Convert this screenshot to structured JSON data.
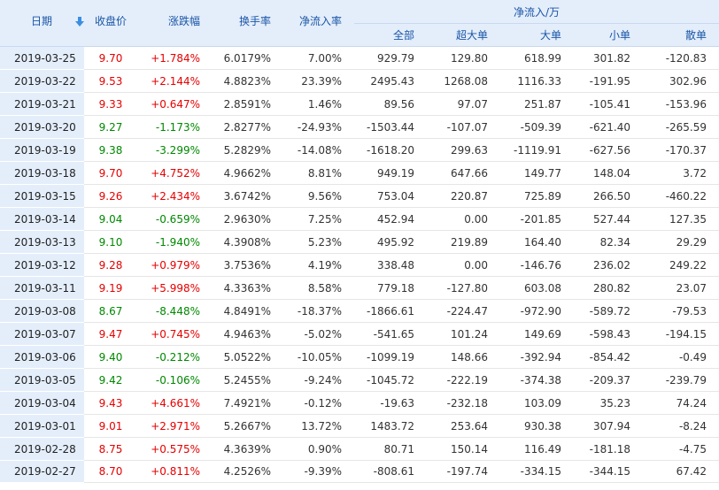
{
  "colors": {
    "up": "#e60000",
    "down": "#008800",
    "header_bg": "#e4eefb",
    "header_text": "#1a55a6"
  },
  "header": {
    "date": "日期",
    "sort_icon": "sort-down-arrow-icon",
    "close": "收盘价",
    "change": "涨跌幅",
    "turnover": "换手率",
    "net_rate": "净流入率",
    "net_group": "净流入/万",
    "all": "全部",
    "super_large": "超大单",
    "large": "大单",
    "small": "小单",
    "retail": "散单"
  },
  "rows": [
    {
      "date": "2019-03-25",
      "close": "9.70",
      "change": "+1.784%",
      "turnover": "6.0179%",
      "rate": "7.00%",
      "all": "929.79",
      "super": "129.80",
      "large": "618.99",
      "small": "301.82",
      "retail": "-120.83",
      "dir": "up"
    },
    {
      "date": "2019-03-22",
      "close": "9.53",
      "change": "+2.144%",
      "turnover": "4.8823%",
      "rate": "23.39%",
      "all": "2495.43",
      "super": "1268.08",
      "large": "1116.33",
      "small": "-191.95",
      "retail": "302.96",
      "dir": "up"
    },
    {
      "date": "2019-03-21",
      "close": "9.33",
      "change": "+0.647%",
      "turnover": "2.8591%",
      "rate": "1.46%",
      "all": "89.56",
      "super": "97.07",
      "large": "251.87",
      "small": "-105.41",
      "retail": "-153.96",
      "dir": "up"
    },
    {
      "date": "2019-03-20",
      "close": "9.27",
      "change": "-1.173%",
      "turnover": "2.8277%",
      "rate": "-24.93%",
      "all": "-1503.44",
      "super": "-107.07",
      "large": "-509.39",
      "small": "-621.40",
      "retail": "-265.59",
      "dir": "down"
    },
    {
      "date": "2019-03-19",
      "close": "9.38",
      "change": "-3.299%",
      "turnover": "5.2829%",
      "rate": "-14.08%",
      "all": "-1618.20",
      "super": "299.63",
      "large": "-1119.91",
      "small": "-627.56",
      "retail": "-170.37",
      "dir": "down"
    },
    {
      "date": "2019-03-18",
      "close": "9.70",
      "change": "+4.752%",
      "turnover": "4.9662%",
      "rate": "8.81%",
      "all": "949.19",
      "super": "647.66",
      "large": "149.77",
      "small": "148.04",
      "retail": "3.72",
      "dir": "up"
    },
    {
      "date": "2019-03-15",
      "close": "9.26",
      "change": "+2.434%",
      "turnover": "3.6742%",
      "rate": "9.56%",
      "all": "753.04",
      "super": "220.87",
      "large": "725.89",
      "small": "266.50",
      "retail": "-460.22",
      "dir": "up"
    },
    {
      "date": "2019-03-14",
      "close": "9.04",
      "change": "-0.659%",
      "turnover": "2.9630%",
      "rate": "7.25%",
      "all": "452.94",
      "super": "0.00",
      "large": "-201.85",
      "small": "527.44",
      "retail": "127.35",
      "dir": "down"
    },
    {
      "date": "2019-03-13",
      "close": "9.10",
      "change": "-1.940%",
      "turnover": "4.3908%",
      "rate": "5.23%",
      "all": "495.92",
      "super": "219.89",
      "large": "164.40",
      "small": "82.34",
      "retail": "29.29",
      "dir": "down"
    },
    {
      "date": "2019-03-12",
      "close": "9.28",
      "change": "+0.979%",
      "turnover": "3.7536%",
      "rate": "4.19%",
      "all": "338.48",
      "super": "0.00",
      "large": "-146.76",
      "small": "236.02",
      "retail": "249.22",
      "dir": "up"
    },
    {
      "date": "2019-03-11",
      "close": "9.19",
      "change": "+5.998%",
      "turnover": "4.3363%",
      "rate": "8.58%",
      "all": "779.18",
      "super": "-127.80",
      "large": "603.08",
      "small": "280.82",
      "retail": "23.07",
      "dir": "up"
    },
    {
      "date": "2019-03-08",
      "close": "8.67",
      "change": "-8.448%",
      "turnover": "4.8491%",
      "rate": "-18.37%",
      "all": "-1866.61",
      "super": "-224.47",
      "large": "-972.90",
      "small": "-589.72",
      "retail": "-79.53",
      "dir": "down"
    },
    {
      "date": "2019-03-07",
      "close": "9.47",
      "change": "+0.745%",
      "turnover": "4.9463%",
      "rate": "-5.02%",
      "all": "-541.65",
      "super": "101.24",
      "large": "149.69",
      "small": "-598.43",
      "retail": "-194.15",
      "dir": "up"
    },
    {
      "date": "2019-03-06",
      "close": "9.40",
      "change": "-0.212%",
      "turnover": "5.0522%",
      "rate": "-10.05%",
      "all": "-1099.19",
      "super": "148.66",
      "large": "-392.94",
      "small": "-854.42",
      "retail": "-0.49",
      "dir": "down"
    },
    {
      "date": "2019-03-05",
      "close": "9.42",
      "change": "-0.106%",
      "turnover": "5.2455%",
      "rate": "-9.24%",
      "all": "-1045.72",
      "super": "-222.19",
      "large": "-374.38",
      "small": "-209.37",
      "retail": "-239.79",
      "dir": "down"
    },
    {
      "date": "2019-03-04",
      "close": "9.43",
      "change": "+4.661%",
      "turnover": "7.4921%",
      "rate": "-0.12%",
      "all": "-19.63",
      "super": "-232.18",
      "large": "103.09",
      "small": "35.23",
      "retail": "74.24",
      "dir": "up"
    },
    {
      "date": "2019-03-01",
      "close": "9.01",
      "change": "+2.971%",
      "turnover": "5.2667%",
      "rate": "13.72%",
      "all": "1483.72",
      "super": "253.64",
      "large": "930.38",
      "small": "307.94",
      "retail": "-8.24",
      "dir": "up"
    },
    {
      "date": "2019-02-28",
      "close": "8.75",
      "change": "+0.575%",
      "turnover": "4.3639%",
      "rate": "0.90%",
      "all": "80.71",
      "super": "150.14",
      "large": "116.49",
      "small": "-181.18",
      "retail": "-4.75",
      "dir": "up"
    },
    {
      "date": "2019-02-27",
      "close": "8.70",
      "change": "+0.811%",
      "turnover": "4.2526%",
      "rate": "-9.39%",
      "all": "-808.61",
      "super": "-197.74",
      "large": "-334.15",
      "small": "-344.15",
      "retail": "67.42",
      "dir": "up"
    }
  ]
}
